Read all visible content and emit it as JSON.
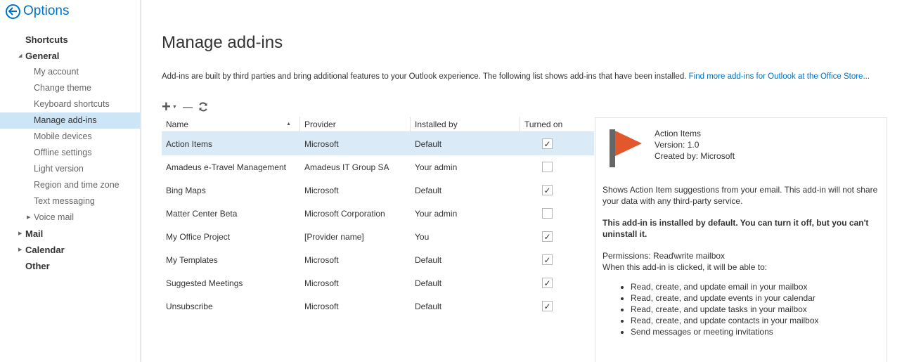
{
  "header": {
    "title": "Options",
    "back_icon": "back-arrow-icon",
    "accent": "#0072c6"
  },
  "sidebar": {
    "items": [
      {
        "label": "Shortcuts"
      },
      {
        "label": "General"
      },
      {
        "label": "My account"
      },
      {
        "label": "Change theme"
      },
      {
        "label": "Keyboard shortcuts"
      },
      {
        "label": "Manage add-ins"
      },
      {
        "label": "Mobile devices"
      },
      {
        "label": "Offline settings"
      },
      {
        "label": "Light version"
      },
      {
        "label": "Region and time zone"
      },
      {
        "label": "Text messaging"
      },
      {
        "label": "Voice mail"
      },
      {
        "label": "Mail"
      },
      {
        "label": "Calendar"
      },
      {
        "label": "Other"
      }
    ],
    "selected": "Manage add-ins"
  },
  "main": {
    "title": "Manage add-ins",
    "description": "Add-ins are built by third parties and bring additional features to your Outlook experience. The following list shows add-ins that have been installed.",
    "store_link": "Find more add-ins for Outlook at the Office Store..."
  },
  "table": {
    "headers": {
      "name": "Name",
      "provider": "Provider",
      "installed_by": "Installed by",
      "turned_on": "Turned on"
    },
    "rows": [
      {
        "name": "Action Items",
        "provider": "Microsoft",
        "installed_by": "Default",
        "turned_on": true
      },
      {
        "name": "Amadeus e-Travel Management",
        "provider": "Amadeus IT Group SA",
        "installed_by": "Your admin",
        "turned_on": false
      },
      {
        "name": "Bing Maps",
        "provider": "Microsoft",
        "installed_by": "Default",
        "turned_on": true
      },
      {
        "name": "Matter Center Beta",
        "provider": "Microsoft Corporation",
        "installed_by": "Your admin",
        "turned_on": false
      },
      {
        "name": "My Office Project",
        "provider": "[Provider name]",
        "installed_by": "You",
        "turned_on": true
      },
      {
        "name": "My Templates",
        "provider": "Microsoft",
        "installed_by": "Default",
        "turned_on": true
      },
      {
        "name": "Suggested Meetings",
        "provider": "Microsoft",
        "installed_by": "Default",
        "turned_on": true
      },
      {
        "name": "Unsubscribe",
        "provider": "Microsoft",
        "installed_by": "Default",
        "turned_on": true
      }
    ],
    "selected_row": "Action Items"
  },
  "detail": {
    "name": "Action Items",
    "version": "Version: 1.0",
    "created_by": "Created by: Microsoft",
    "logo_colors": {
      "bar": "#666666",
      "flag": "#e2572c"
    },
    "description": "Shows Action Item suggestions from your email. This add-in will not share your data with any third-party service.",
    "default_note": "This add-in is installed by default. You can turn it off, but you can't uninstall it.",
    "permissions": "Permissions: Read\\write mailbox",
    "abilities_intro": "When this add-in is clicked, it will be able to:",
    "abilities": [
      "Read, create, and update email in your mailbox",
      "Read, create, and update events in your calendar",
      "Read, create, and update tasks in your mailbox",
      "Read, create, and update contacts in your mailbox",
      "Send messages or meeting invitations"
    ]
  }
}
